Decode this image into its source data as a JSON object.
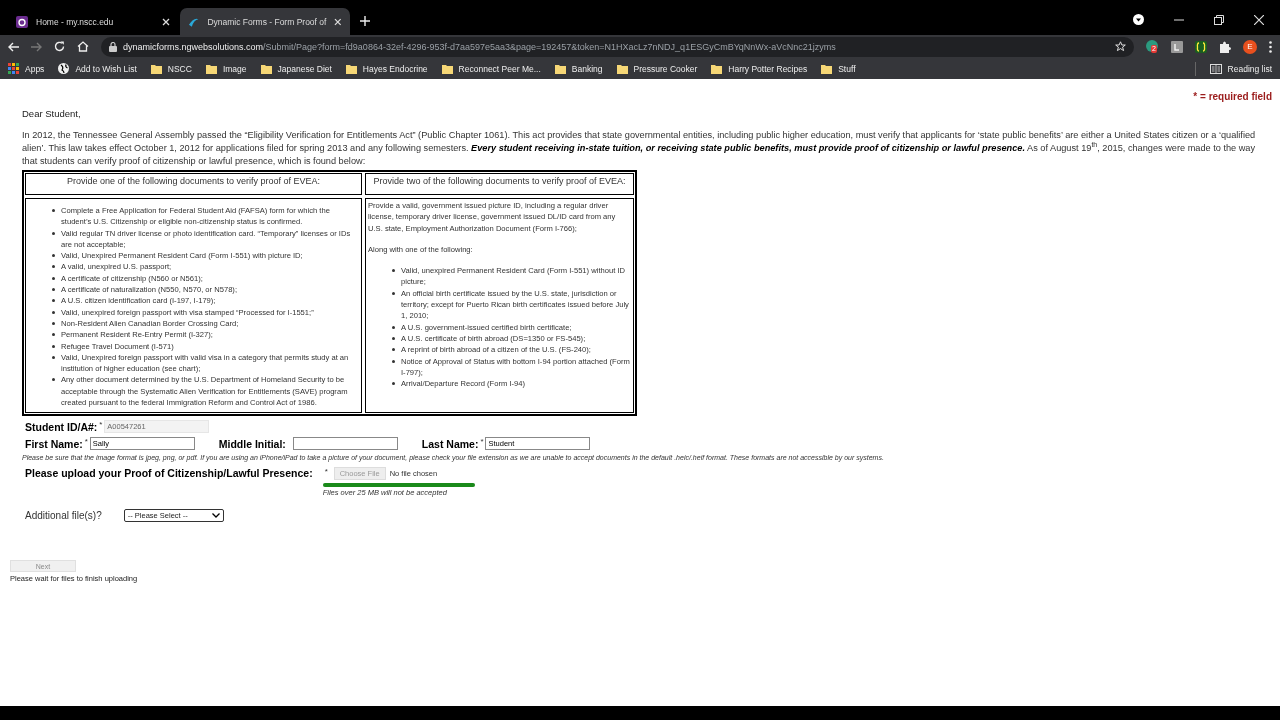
{
  "browser": {
    "tabs": [
      {
        "title": "Home - my.nscc.edu",
        "selected": false
      },
      {
        "title": "Dynamic Forms - Form Proof of",
        "selected": true
      }
    ],
    "address": {
      "domain": "dynamicforms.ngwebsolutions.com",
      "path": "/Submit/Page?form=fd9a0864-32ef-4296-953f-d7aa597e5aa3&page=192457&token=N1HXacLz7nNDJ_q1ESGyCmBYqNnWx-aVcNnc21jzyms"
    },
    "extension_badge": "2",
    "profile_initial": "E",
    "bookmarks": [
      {
        "label": "Apps",
        "kind": "apps"
      },
      {
        "label": "Add to Wish List",
        "kind": "globe"
      },
      {
        "label": "NSCC",
        "kind": "folder"
      },
      {
        "label": "Image",
        "kind": "folder"
      },
      {
        "label": "Japanese Diet",
        "kind": "folder"
      },
      {
        "label": "Hayes Endocrine",
        "kind": "folder"
      },
      {
        "label": "Reconnect Peer Me...",
        "kind": "folder"
      },
      {
        "label": "Banking",
        "kind": "folder"
      },
      {
        "label": "Pressure Cooker",
        "kind": "folder"
      },
      {
        "label": "Harry Potter Recipes",
        "kind": "folder"
      },
      {
        "label": "Stuff",
        "kind": "folder"
      }
    ],
    "reading_list": "Reading list"
  },
  "page": {
    "required_note": "* = required field",
    "greeting": "Dear Student,",
    "intro": "In 2012, the Tennessee General Assembly passed the “Eligibility Verification for Entitlements Act” (Public Chapter 1061).  This act provides that state governmental entities, including public higher education, must verify that applicants for ‘state public benefits’ are either a United States citizen or a ‘qualified alien’.   This law takes effect October 1, 2012 for applications filed for spring 2013 and any following semesters.  **Every student receiving in-state tuition, or receiving state public benefits, must provide proof of citizenship or lawful presence.** As of August 19$^{th}$, 2015, changes were made to the way that students can verify proof of citizenship or lawful presence, which is found below:",
    "documents_table": {
      "columns": [
        {
          "heading": "Provide one of the following documents to verify proof of EVEA:",
          "items": [
            "Complete a Free Application for Federal Student Aid (FAFSA) form for which the student’s U.S. Citizenship or eligible non-citizenship status is confirmed.",
            "Valid regular TN driver license or photo identification card.  “Temporary” licenses or IDs are not acceptable;",
            "Valid, Unexpired Permanent Resident Card (Form I-551) with picture ID;",
            "A valid, unexpired U.S. passport;",
            "A certificate of citizenship (N560 or N561);",
            "A certificate of naturalization (N550, N570, or N578);",
            "A U.S. citizen identification card (I-197, I-179);",
            "Valid, unexpired foreign passport with visa stamped “Processed for I-1551;”",
            "Non-Resident Alien Canadian Border Crossing Card;",
            "Permanent Resident Re-Entry Permit (I-327);",
            "Refugee Travel Document (I-571)",
            "Valid, Unexpired foreign passport with valid visa in a category that permits study at an institution of higher education (see chart);",
            "Any other document determined by the U.S. Department of Homeland Security to be acceptable through the Systematic Alien Verification for Entitlements (SAVE) program created pursuant to the federal Immigration Reform and Control Act of 1986."
          ]
        },
        {
          "heading": "Provide two of the following documents to verify proof of EVEA:",
          "paragraphs": [
            "Provide a valid, government issued picture ID, including a regular driver license, temporary driver license, government issued DL/ID card from any U.S. state, Employment Authorization Document (Form I-766);",
            "Along with one of the following:"
          ],
          "items": [
            "Valid, unexpired Permanent Resident Card (Form I-551) without ID picture;",
            "An official birth certificate issued by the U.S. state, jurisdiction or territory; except for Puerto Rican birth certificates issued before July 1, 2010;",
            "A U.S. government-issued certified birth certificate;",
            "A U.S. certificate of birth abroad (DS=1350 or FS-545);",
            "A reprint of birth abroad of a citizen of the U.S. (FS-240);",
            "Notice of Approval of Status with bottom I-94 portion attached (Form I-797);",
            "Arrival/Departure Record (Form I-94)"
          ]
        }
      ]
    },
    "form": {
      "field_rows": [
        [
          {
            "label": "Student ID/A#:",
            "required_mark": "*",
            "value": "A00547261",
            "disabled": true
          }
        ],
        [
          {
            "label": "First Name:",
            "required_mark": "*",
            "value": "Sally",
            "disabled": false
          },
          {
            "label": "Middle Initial:",
            "disabled": false
          },
          {
            "label": "Last Name:",
            "required_mark": "*",
            "value": "Student",
            "disabled": false
          }
        ]
      ],
      "format_note": "Please be sure that the image format is jpeg, png, or pdf. If you are using an iPhone/iPad to take a picture of your document, please check your file extension as we are unable to accept documents in the default .heic/.heif format. These formats are not accessible by our systems.",
      "upload": {
        "label": "Please upload your Proof of Citizenship/Lawful Presence:",
        "required_mark": "*",
        "button": "Choose File",
        "button_disabled": true,
        "file_status": "No file chosen",
        "level": 1,
        "size_note": "Files over 25 MB will not be accepted"
      },
      "additional": {
        "label": "Additional file(s)?",
        "value": "-- Please Select --"
      },
      "next": {
        "label": "Next",
        "disabled": true
      },
      "wait_note": "Please wait for files to finish uploading"
    }
  }
}
